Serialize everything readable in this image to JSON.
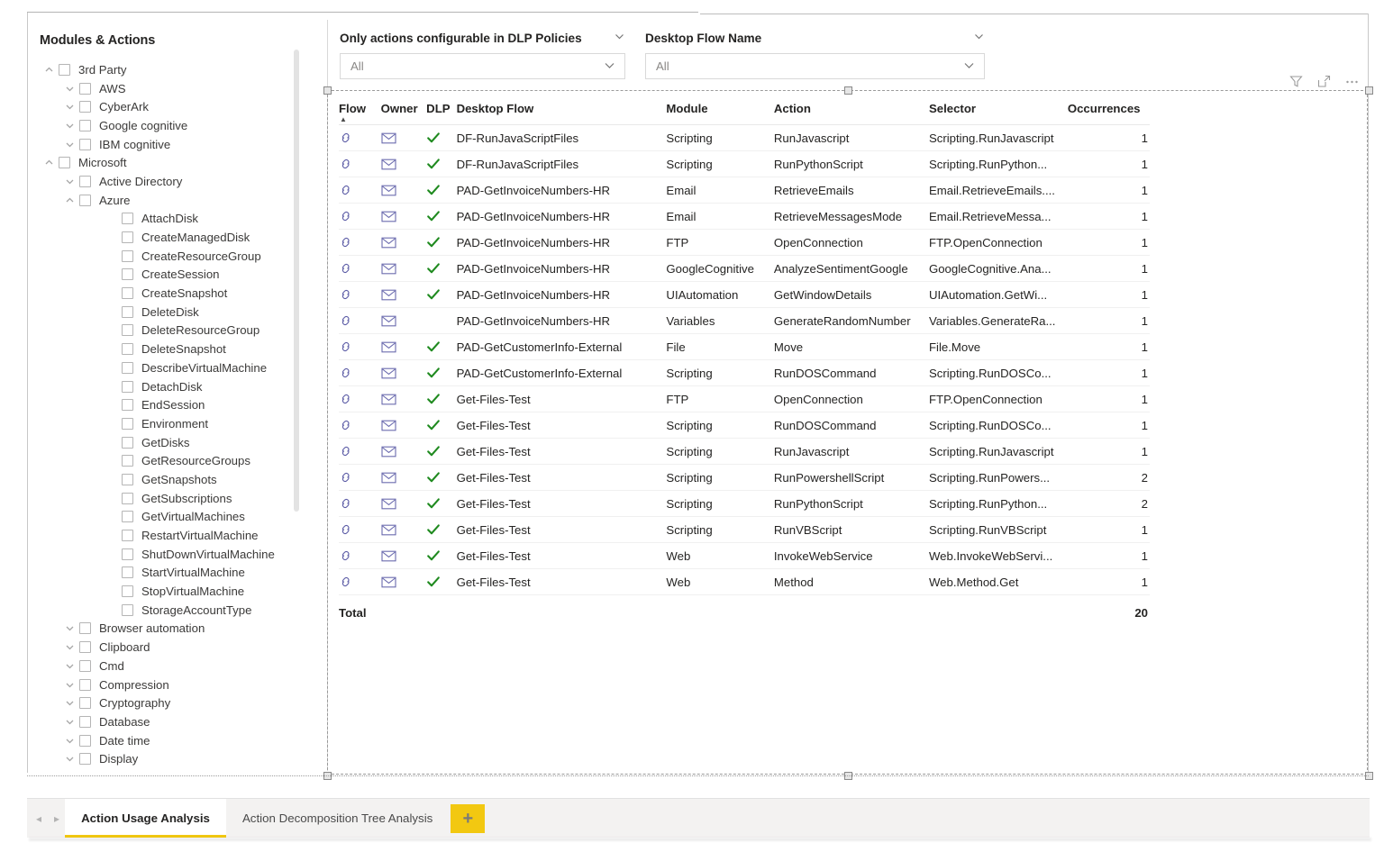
{
  "tree_panel": {
    "title": "Modules & Actions",
    "nodes": [
      {
        "label": "3rd Party",
        "indent": 0,
        "chevron": "up",
        "checkbox": true
      },
      {
        "label": "AWS",
        "indent": 1,
        "chevron": "down",
        "checkbox": true
      },
      {
        "label": "CyberArk",
        "indent": 1,
        "chevron": "down",
        "checkbox": true
      },
      {
        "label": "Google cognitive",
        "indent": 1,
        "chevron": "down",
        "checkbox": true
      },
      {
        "label": "IBM cognitive",
        "indent": 1,
        "chevron": "down",
        "checkbox": true
      },
      {
        "label": "Microsoft",
        "indent": 0,
        "chevron": "up",
        "checkbox": true
      },
      {
        "label": "Active Directory",
        "indent": 1,
        "chevron": "down",
        "checkbox": true
      },
      {
        "label": "Azure",
        "indent": 1,
        "chevron": "up",
        "checkbox": true
      },
      {
        "label": "AttachDisk",
        "indent": 3,
        "chevron": "none",
        "checkbox": true
      },
      {
        "label": "CreateManagedDisk",
        "indent": 3,
        "chevron": "none",
        "checkbox": true
      },
      {
        "label": "CreateResourceGroup",
        "indent": 3,
        "chevron": "none",
        "checkbox": true
      },
      {
        "label": "CreateSession",
        "indent": 3,
        "chevron": "none",
        "checkbox": true
      },
      {
        "label": "CreateSnapshot",
        "indent": 3,
        "chevron": "none",
        "checkbox": true
      },
      {
        "label": "DeleteDisk",
        "indent": 3,
        "chevron": "none",
        "checkbox": true
      },
      {
        "label": "DeleteResourceGroup",
        "indent": 3,
        "chevron": "none",
        "checkbox": true
      },
      {
        "label": "DeleteSnapshot",
        "indent": 3,
        "chevron": "none",
        "checkbox": true
      },
      {
        "label": "DescribeVirtualMachine",
        "indent": 3,
        "chevron": "none",
        "checkbox": true
      },
      {
        "label": "DetachDisk",
        "indent": 3,
        "chevron": "none",
        "checkbox": true
      },
      {
        "label": "EndSession",
        "indent": 3,
        "chevron": "none",
        "checkbox": true
      },
      {
        "label": "Environment",
        "indent": 3,
        "chevron": "none",
        "checkbox": true
      },
      {
        "label": "GetDisks",
        "indent": 3,
        "chevron": "none",
        "checkbox": true
      },
      {
        "label": "GetResourceGroups",
        "indent": 3,
        "chevron": "none",
        "checkbox": true
      },
      {
        "label": "GetSnapshots",
        "indent": 3,
        "chevron": "none",
        "checkbox": true
      },
      {
        "label": "GetSubscriptions",
        "indent": 3,
        "chevron": "none",
        "checkbox": true
      },
      {
        "label": "GetVirtualMachines",
        "indent": 3,
        "chevron": "none",
        "checkbox": true
      },
      {
        "label": "RestartVirtualMachine",
        "indent": 3,
        "chevron": "none",
        "checkbox": true
      },
      {
        "label": "ShutDownVirtualMachine",
        "indent": 3,
        "chevron": "none",
        "checkbox": true
      },
      {
        "label": "StartVirtualMachine",
        "indent": 3,
        "chevron": "none",
        "checkbox": true
      },
      {
        "label": "StopVirtualMachine",
        "indent": 3,
        "chevron": "none",
        "checkbox": true
      },
      {
        "label": "StorageAccountType",
        "indent": 3,
        "chevron": "none",
        "checkbox": true
      },
      {
        "label": "Browser automation",
        "indent": 1,
        "chevron": "down",
        "checkbox": true
      },
      {
        "label": "Clipboard",
        "indent": 1,
        "chevron": "down",
        "checkbox": true
      },
      {
        "label": "Cmd",
        "indent": 1,
        "chevron": "down",
        "checkbox": true
      },
      {
        "label": "Compression",
        "indent": 1,
        "chevron": "down",
        "checkbox": true
      },
      {
        "label": "Cryptography",
        "indent": 1,
        "chevron": "down",
        "checkbox": true
      },
      {
        "label": "Database",
        "indent": 1,
        "chevron": "down",
        "checkbox": true
      },
      {
        "label": "Date time",
        "indent": 1,
        "chevron": "down",
        "checkbox": true
      },
      {
        "label": "Display",
        "indent": 1,
        "chevron": "down",
        "checkbox": true
      }
    ]
  },
  "slicers": [
    {
      "title": "Only actions configurable in DLP Policies",
      "value": "All"
    },
    {
      "title": "Desktop Flow Name",
      "value": "All"
    }
  ],
  "visual_toolbar": {
    "filter_icon": "filter-icon",
    "focus_icon": "focus-mode-icon",
    "more_icon": "more-options-icon"
  },
  "table": {
    "sort_column": "Flow",
    "sort_direction": "ascending",
    "columns": [
      "Flow",
      "Owner",
      "DLP",
      "Desktop Flow",
      "Module",
      "Action",
      "Selector",
      "Occurrences"
    ],
    "rows": [
      {
        "flow_icon": "link-icon",
        "owner_icon": "envelope-icon",
        "dlp": true,
        "desktop_flow": "DF-RunJavaScriptFiles",
        "module": "Scripting",
        "action": "RunJavascript",
        "selector": "Scripting.RunJavascript",
        "occurrences": "1"
      },
      {
        "flow_icon": "link-icon",
        "owner_icon": "envelope-icon",
        "dlp": true,
        "desktop_flow": "DF-RunJavaScriptFiles",
        "module": "Scripting",
        "action": "RunPythonScript",
        "selector": "Scripting.RunPython...",
        "occurrences": "1"
      },
      {
        "flow_icon": "link-icon",
        "owner_icon": "envelope-icon",
        "dlp": true,
        "desktop_flow": "PAD-GetInvoiceNumbers-HR",
        "module": "Email",
        "action": "RetrieveEmails",
        "selector": "Email.RetrieveEmails....",
        "occurrences": "1"
      },
      {
        "flow_icon": "link-icon",
        "owner_icon": "envelope-icon",
        "dlp": true,
        "desktop_flow": "PAD-GetInvoiceNumbers-HR",
        "module": "Email",
        "action": "RetrieveMessagesMode",
        "selector": "Email.RetrieveMessa...",
        "occurrences": "1"
      },
      {
        "flow_icon": "link-icon",
        "owner_icon": "envelope-icon",
        "dlp": true,
        "desktop_flow": "PAD-GetInvoiceNumbers-HR",
        "module": "FTP",
        "action": "OpenConnection",
        "selector": "FTP.OpenConnection",
        "occurrences": "1"
      },
      {
        "flow_icon": "link-icon",
        "owner_icon": "envelope-icon",
        "dlp": true,
        "desktop_flow": "PAD-GetInvoiceNumbers-HR",
        "module": "GoogleCognitive",
        "action": "AnalyzeSentimentGoogle",
        "selector": "GoogleCognitive.Ana...",
        "occurrences": "1"
      },
      {
        "flow_icon": "link-icon",
        "owner_icon": "envelope-icon",
        "dlp": true,
        "desktop_flow": "PAD-GetInvoiceNumbers-HR",
        "module": "UIAutomation",
        "action": "GetWindowDetails",
        "selector": "UIAutomation.GetWi...",
        "occurrences": "1"
      },
      {
        "flow_icon": "link-icon",
        "owner_icon": "envelope-icon",
        "dlp": false,
        "desktop_flow": "PAD-GetInvoiceNumbers-HR",
        "module": "Variables",
        "action": "GenerateRandomNumber",
        "selector": "Variables.GenerateRa...",
        "occurrences": "1"
      },
      {
        "flow_icon": "link-icon",
        "owner_icon": "envelope-icon",
        "dlp": true,
        "desktop_flow": "PAD-GetCustomerInfo-External",
        "module": "File",
        "action": "Move",
        "selector": "File.Move",
        "occurrences": "1"
      },
      {
        "flow_icon": "link-icon",
        "owner_icon": "envelope-icon",
        "dlp": true,
        "desktop_flow": "PAD-GetCustomerInfo-External",
        "module": "Scripting",
        "action": "RunDOSCommand",
        "selector": "Scripting.RunDOSCo...",
        "occurrences": "1"
      },
      {
        "flow_icon": "link-icon",
        "owner_icon": "envelope-icon",
        "dlp": true,
        "desktop_flow": "Get-Files-Test",
        "module": "FTP",
        "action": "OpenConnection",
        "selector": "FTP.OpenConnection",
        "occurrences": "1"
      },
      {
        "flow_icon": "link-icon",
        "owner_icon": "envelope-icon",
        "dlp": true,
        "desktop_flow": "Get-Files-Test",
        "module": "Scripting",
        "action": "RunDOSCommand",
        "selector": "Scripting.RunDOSCo...",
        "occurrences": "1"
      },
      {
        "flow_icon": "link-icon",
        "owner_icon": "envelope-icon",
        "dlp": true,
        "desktop_flow": "Get-Files-Test",
        "module": "Scripting",
        "action": "RunJavascript",
        "selector": "Scripting.RunJavascript",
        "occurrences": "1"
      },
      {
        "flow_icon": "link-icon",
        "owner_icon": "envelope-icon",
        "dlp": true,
        "desktop_flow": "Get-Files-Test",
        "module": "Scripting",
        "action": "RunPowershellScript",
        "selector": "Scripting.RunPowers...",
        "occurrences": "2"
      },
      {
        "flow_icon": "link-icon",
        "owner_icon": "envelope-icon",
        "dlp": true,
        "desktop_flow": "Get-Files-Test",
        "module": "Scripting",
        "action": "RunPythonScript",
        "selector": "Scripting.RunPython...",
        "occurrences": "2"
      },
      {
        "flow_icon": "link-icon",
        "owner_icon": "envelope-icon",
        "dlp": true,
        "desktop_flow": "Get-Files-Test",
        "module": "Scripting",
        "action": "RunVBScript",
        "selector": "Scripting.RunVBScript",
        "occurrences": "1"
      },
      {
        "flow_icon": "link-icon",
        "owner_icon": "envelope-icon",
        "dlp": true,
        "desktop_flow": "Get-Files-Test",
        "module": "Web",
        "action": "InvokeWebService",
        "selector": "Web.InvokeWebServi...",
        "occurrences": "1"
      },
      {
        "flow_icon": "link-icon",
        "owner_icon": "envelope-icon",
        "dlp": true,
        "desktop_flow": "Get-Files-Test",
        "module": "Web",
        "action": "Method",
        "selector": "Web.Method.Get",
        "occurrences": "1"
      }
    ],
    "total_label": "Total",
    "total_value": "20"
  },
  "tabbar": {
    "prev_label": "◂",
    "next_label": "▸",
    "tabs": [
      {
        "label": "Action Usage Analysis",
        "active": true
      },
      {
        "label": "Action Decomposition Tree Analysis",
        "active": false
      }
    ],
    "add_label": "+"
  },
  "colors": {
    "accent_yellow": "#F2C811",
    "dlp_check_green": "#1F8A1F",
    "icon_purple": "#5C5CA6",
    "text": "#252423"
  }
}
